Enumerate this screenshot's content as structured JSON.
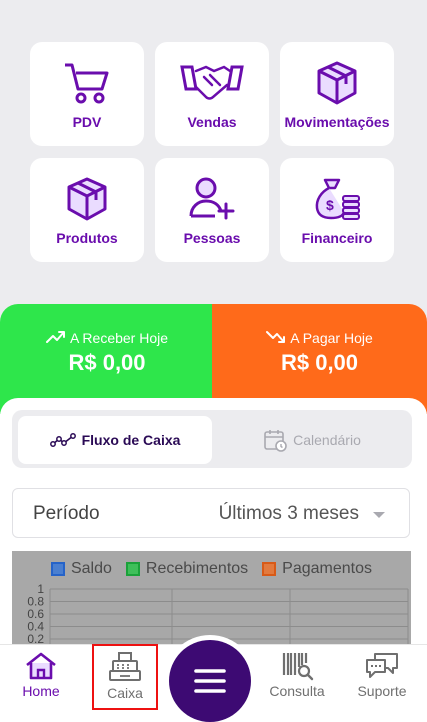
{
  "colors": {
    "purple": "#6a0dad",
    "green": "#2ee64b",
    "orange": "#ff6a1a",
    "dark_purple": "#3d0a73"
  },
  "tiles": [
    {
      "label": "PDV",
      "icon": "cart-icon"
    },
    {
      "label": "Vendas",
      "icon": "handshake-icon"
    },
    {
      "label": "Movimentações",
      "icon": "box-icon"
    },
    {
      "label": "Produtos",
      "icon": "box-icon"
    },
    {
      "label": "Pessoas",
      "icon": "person-add-icon"
    },
    {
      "label": "Financeiro",
      "icon": "money-bag-icon"
    }
  ],
  "receber": {
    "label": "A Receber Hoje",
    "value": "R$ 0,00"
  },
  "pagar": {
    "label": "A Pagar Hoje",
    "value": "R$ 0,00"
  },
  "tabs": {
    "active": "Fluxo de Caixa",
    "inactive": "Calendário"
  },
  "period": {
    "label": "Período",
    "value": "Últimos 3 meses"
  },
  "chart_data": {
    "type": "bar",
    "series": [
      {
        "name": "Saldo",
        "values": [],
        "color": "#2563c9"
      },
      {
        "name": "Recebimentos",
        "values": [],
        "color": "#1aa23a"
      },
      {
        "name": "Pagamentos",
        "values": [],
        "color": "#d85a17"
      }
    ],
    "yticks": [
      "1",
      "0.8",
      "0.6",
      "0.4",
      "0.2"
    ],
    "ylim": [
      0,
      1
    ]
  },
  "nav": {
    "home": "Home",
    "caixa": "Caixa",
    "consulta": "Consulta",
    "suporte": "Suporte"
  }
}
